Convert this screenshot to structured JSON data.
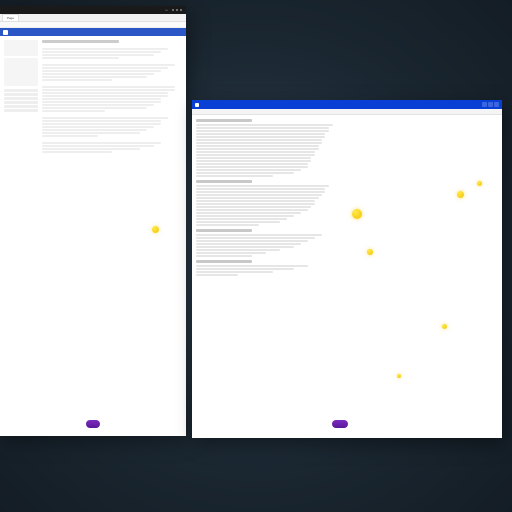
{
  "desktop": {
    "accent_yellow": "#f2c200",
    "accent_purple": "#6a1fb0"
  },
  "window_left": {
    "titlebar": {
      "indicator": "•••"
    },
    "tab": {
      "label": "Page"
    },
    "bluebar": {
      "brand": " "
    },
    "sidebar": {
      "cards": [
        "",
        ""
      ],
      "items": [
        "",
        "",
        "",
        "",
        "",
        ""
      ]
    },
    "article": {
      "heading": "",
      "paragraphs": [
        [
          "",
          "",
          "",
          ""
        ],
        [
          "",
          "",
          "",
          "",
          "",
          ""
        ],
        [
          "",
          "",
          "",
          "",
          "",
          "",
          "",
          "",
          ""
        ],
        [
          "",
          "",
          "",
          "",
          "",
          "",
          ""
        ],
        [
          "",
          "",
          "",
          ""
        ]
      ]
    },
    "footer": {
      "button": ""
    }
  },
  "window_right": {
    "titlebar": {
      "title": ""
    },
    "menu": {
      "items": [
        "",
        "",
        "",
        "",
        ""
      ]
    },
    "list": {
      "sections": [
        {
          "heading": "",
          "rows": [
            "",
            "",
            "",
            "",
            "",
            "",
            "",
            "",
            "",
            "",
            "",
            "",
            "",
            "",
            "",
            "",
            "",
            ""
          ]
        },
        {
          "heading": "",
          "rows": [
            "",
            "",
            "",
            "",
            "",
            "",
            "",
            "",
            "",
            "",
            "",
            "",
            "",
            ""
          ]
        },
        {
          "heading": "",
          "rows": [
            "",
            "",
            "",
            "",
            "",
            "",
            "",
            ""
          ]
        },
        {
          "heading": "",
          "rows": [
            "",
            "",
            "",
            ""
          ]
        }
      ]
    },
    "markers": [
      {
        "name": "marker-1"
      },
      {
        "name": "marker-2"
      },
      {
        "name": "marker-3"
      },
      {
        "name": "marker-4"
      },
      {
        "name": "marker-5"
      },
      {
        "name": "marker-6"
      }
    ],
    "footer": {
      "button": ""
    }
  }
}
